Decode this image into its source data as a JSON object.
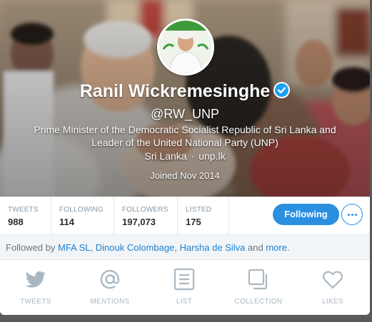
{
  "profile": {
    "name": "Ranil Wickremesinghe",
    "handle": "@RW_UNP",
    "bio": "Prime Minister of the Democratic Socialist Republic of Sri Lanka and Leader of the United National Party (UNP)",
    "location": "Sri Lanka",
    "separator": "·",
    "website": "unp.lk",
    "joined": "Joined Nov 2014",
    "verified_icon": "verified-badge-icon"
  },
  "stats": [
    {
      "label": "TWEETS",
      "value": "988"
    },
    {
      "label": "FOLLOWING",
      "value": "114"
    },
    {
      "label": "FOLLOWERS",
      "value": "197,073"
    },
    {
      "label": "LISTED",
      "value": "175"
    }
  ],
  "actions": {
    "follow_label": "Following",
    "more_icon": "ellipsis-icon"
  },
  "followed_by": {
    "prefix": "Followed by",
    "names": [
      "MFA SL",
      "Dinouk Colombage",
      "Harsha de Silva"
    ],
    "sep": ",",
    "and": "and",
    "more": "more",
    "end": "."
  },
  "tabs": [
    {
      "label": "TWEETS",
      "icon": "bird-icon"
    },
    {
      "label": "MENTIONS",
      "icon": "at-icon"
    },
    {
      "label": "LIST",
      "icon": "list-icon"
    },
    {
      "label": "COLLECTION",
      "icon": "collection-icon"
    },
    {
      "label": "LIKES",
      "icon": "heart-icon"
    }
  ],
  "colors": {
    "accent": "#2b8fe0",
    "link": "#1b7fd4",
    "muted": "#8899a6",
    "tab_icon": "#aab8c2"
  }
}
